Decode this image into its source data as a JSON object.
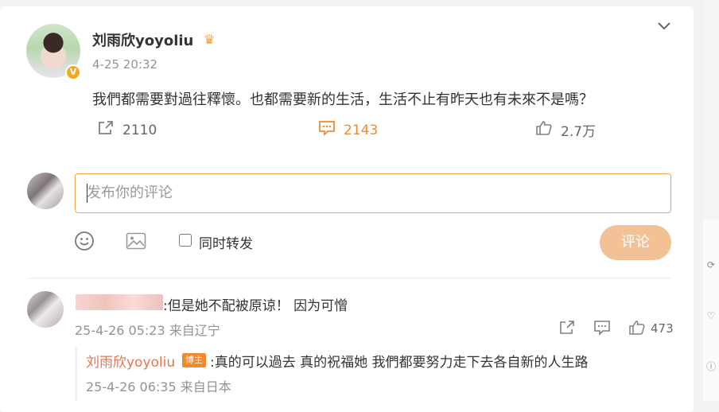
{
  "post": {
    "author": "刘雨欣yoyoliu",
    "verified_badge": "V",
    "time": "4-25 20:32",
    "text": "我們都需要對過往釋懷。也都需要新的生活，生活不止有昨天也有未來不是嗎？",
    "actions": {
      "repost_count": "2110",
      "comment_count": "2143",
      "like_count": "2.7万"
    }
  },
  "composer": {
    "placeholder": "发布你的评论",
    "repost_label": "同时转发",
    "submit_label": "评论"
  },
  "comments": [
    {
      "text": ":但是她不配被原谅！ 因为可憎",
      "meta": "25-4-26 05:23 来自辽宁",
      "like_count": "473",
      "reply": {
        "author": "刘雨欣yoyoliu",
        "badge": "博主",
        "text": ":真的可以過去  真的祝福她 我們都要努力走下去各自新的人生路",
        "meta": "25-4-26 06:35 来自日本"
      }
    }
  ],
  "colors": {
    "accent_orange": "#f08a2c",
    "reply_name": "#eb7350",
    "submit_disabled": "#f2c196",
    "input_border": "#f0a54a"
  },
  "icons": {
    "collapse": "chevron-down-icon",
    "repost": "share-arrow-icon",
    "comment": "comment-bubble-icon",
    "like": "thumbs-up-icon",
    "emoji": "smiley-icon",
    "image": "image-icon"
  }
}
